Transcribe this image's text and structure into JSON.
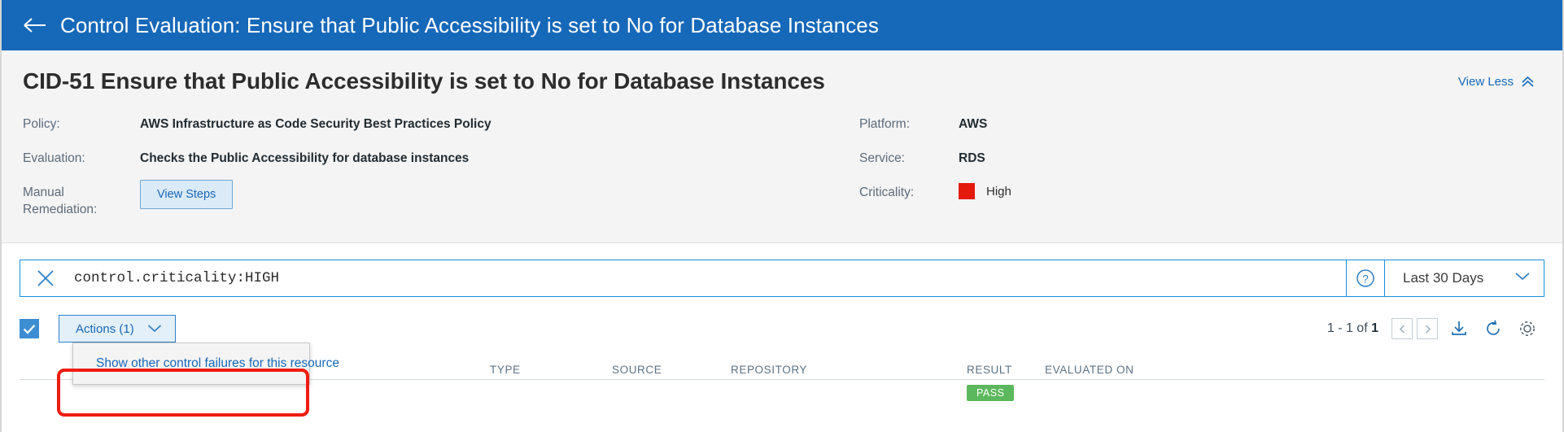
{
  "header": {
    "back_icon": "arrow-left-icon",
    "title": "Control Evaluation: Ensure that Public Accessibility is set to No for Database Instances",
    "bg_color": "#1668b8"
  },
  "detail": {
    "cid_title": "CID-51 Ensure that Public Accessibility is set to No for Database Instances",
    "view_less_label": "View Less",
    "view_less_icon": "chevron-double-up-icon",
    "left_fields": [
      {
        "label": "Policy:",
        "value": "AWS Infrastructure as Code Security Best Practices Policy"
      },
      {
        "label": "Evaluation:",
        "value": "Checks the Public Accessibility for database instances"
      }
    ],
    "manual_remediation_label": "Manual Remediation:",
    "view_steps_label": "View Steps",
    "right_fields": [
      {
        "label": "Platform:",
        "value": "AWS"
      },
      {
        "label": "Service:",
        "value": "RDS"
      }
    ],
    "criticality_label": "Criticality:",
    "criticality_value": "High",
    "criticality_color": "#e31a0c"
  },
  "search": {
    "clear_icon": "close-x-icon",
    "query": "control.criticality:HIGH",
    "help_icon": "question-circle-icon",
    "range_value": "Last 30 Days",
    "range_icon": "chevron-down-icon",
    "border_color": "#1a8fd8"
  },
  "toolbar": {
    "select_all_icon": "checkmark-icon",
    "select_all_checked": true,
    "actions_label": "Actions (1)",
    "actions_caret_icon": "chevron-down-icon",
    "pager_prefix": "1 - 1 of ",
    "pager_total": "1",
    "prev_icon": "chevron-left-icon",
    "next_icon": "chevron-right-icon",
    "download_icon": "download-icon",
    "refresh_icon": "refresh-icon",
    "settings_icon": "gear-icon"
  },
  "actions_menu": {
    "items": [
      {
        "label": "Show other control failures for this resource"
      }
    ],
    "highlight_color": "#f01c11"
  },
  "table": {
    "columns": [
      "",
      "TYPE",
      "SOURCE",
      "REPOSITORY",
      "RESULT",
      "EVALUATED ON"
    ],
    "rows": [
      {
        "name": "",
        "type": "",
        "source": "",
        "repository": "",
        "result": "PASS",
        "evaluated_on": ""
      }
    ],
    "result_pass_color": "#5cb85c"
  }
}
